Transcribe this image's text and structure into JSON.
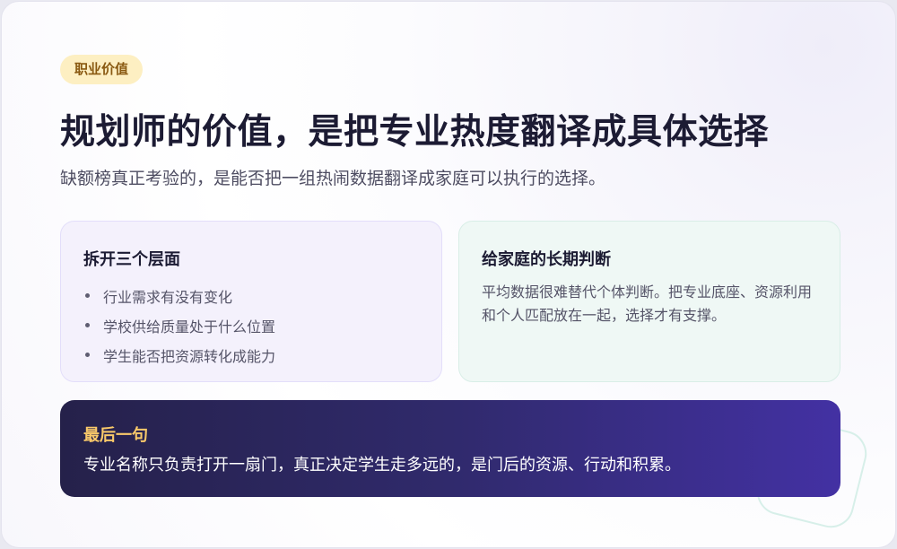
{
  "header": {
    "badge": "职业价值",
    "title": "规划师的价值，是把专业热度翻译成具体选择",
    "subtitle": "缺额榜真正考验的，是能否把一组热闹数据翻译成家庭可以执行的选择。"
  },
  "cards": {
    "left": {
      "title": "拆开三个层面",
      "items": [
        "行业需求有没有变化",
        "学校供给质量处于什么位置",
        "学生能否把资源转化成能力"
      ]
    },
    "right": {
      "title": "给家庭的长期判断",
      "text": "平均数据很难替代个体判断。把专业底座、资源利用和个人匹配放在一起，选择才有支撑。"
    }
  },
  "final": {
    "title": "最后一句",
    "text": "专业名称只负责打开一扇门，真正决定学生走多远的，是门后的资源、行动和积累。"
  },
  "colors": {
    "badge_bg": "#fdefc2",
    "title_text": "#1c1b33",
    "final_title": "#f9c96a",
    "final_gradient_start": "#25214a",
    "final_gradient_end": "#4331a3"
  }
}
